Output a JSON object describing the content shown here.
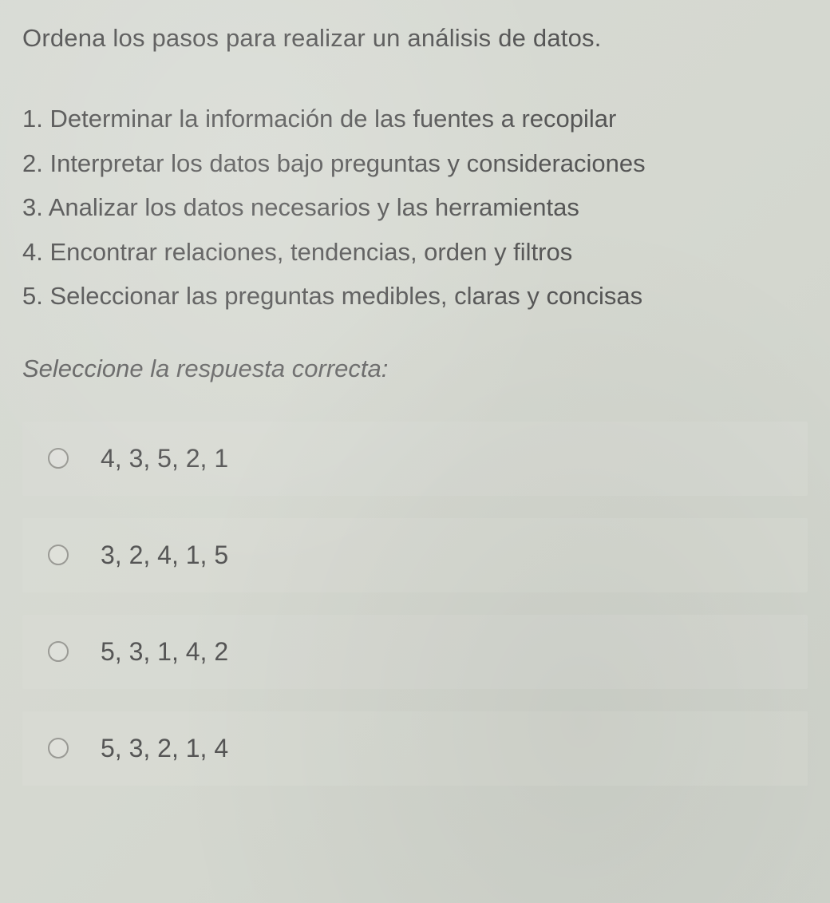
{
  "question": {
    "title": "Ordena los pasos para realizar un análisis de datos.",
    "steps": [
      "1. Determinar la información de las fuentes a recopilar",
      "2. Interpretar los datos bajo preguntas y consideraciones",
      "3. Analizar los datos necesarios y las herramientas",
      "4. Encontrar relaciones, tendencias, orden y filtros",
      "5. Seleccionar las preguntas medibles, claras y concisas"
    ],
    "prompt": "Seleccione la respuesta correcta:"
  },
  "options": [
    {
      "label": "4, 3, 5, 2, 1"
    },
    {
      "label": "3, 2, 4, 1, 5"
    },
    {
      "label": "5, 3, 1, 4, 2"
    },
    {
      "label": "5, 3, 2, 1, 4"
    }
  ]
}
